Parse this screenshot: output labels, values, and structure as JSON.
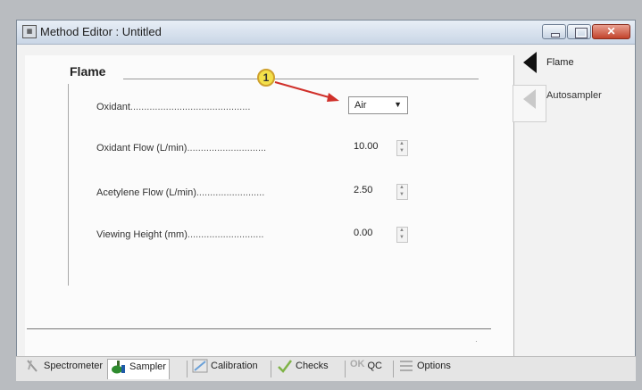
{
  "window": {
    "title": "Method Editor : Untitled"
  },
  "section": {
    "title": "Flame"
  },
  "fields": [
    {
      "label": "Oxidant",
      "value": "Air",
      "type": "dropdown"
    },
    {
      "label": "Oxidant Flow (L/min)",
      "value": "10.00",
      "type": "spinner"
    },
    {
      "label": "Acetylene Flow (L/min)",
      "value": "2.50",
      "type": "spinner"
    },
    {
      "label": "Viewing Height (mm)",
      "value": "0.00",
      "type": "spinner"
    }
  ],
  "callout": {
    "number": "1",
    "color": "#f3e04a",
    "arrow_color": "#d0302a"
  },
  "side_tabs": [
    {
      "label": "Flame",
      "active": true
    },
    {
      "label": "Autosampler",
      "active": false
    }
  ],
  "bottom_tabs": [
    {
      "label": "Spectrometer",
      "icon": "spectrometer-icon"
    },
    {
      "label": "Sampler",
      "icon": "sampler-icon",
      "active": true
    },
    {
      "label": "Calibration",
      "icon": "calibration-icon"
    },
    {
      "label": "Checks",
      "icon": "checks-icon"
    },
    {
      "label": "QC",
      "icon": "qc-icon",
      "icon_text": "OK"
    },
    {
      "label": "Options",
      "icon": "options-icon"
    }
  ],
  "dots": {
    "oxidant": "............................................",
    "oxidant_flow": ".............................",
    "acetylene_flow": ".........................",
    "viewing_height": "............................"
  }
}
